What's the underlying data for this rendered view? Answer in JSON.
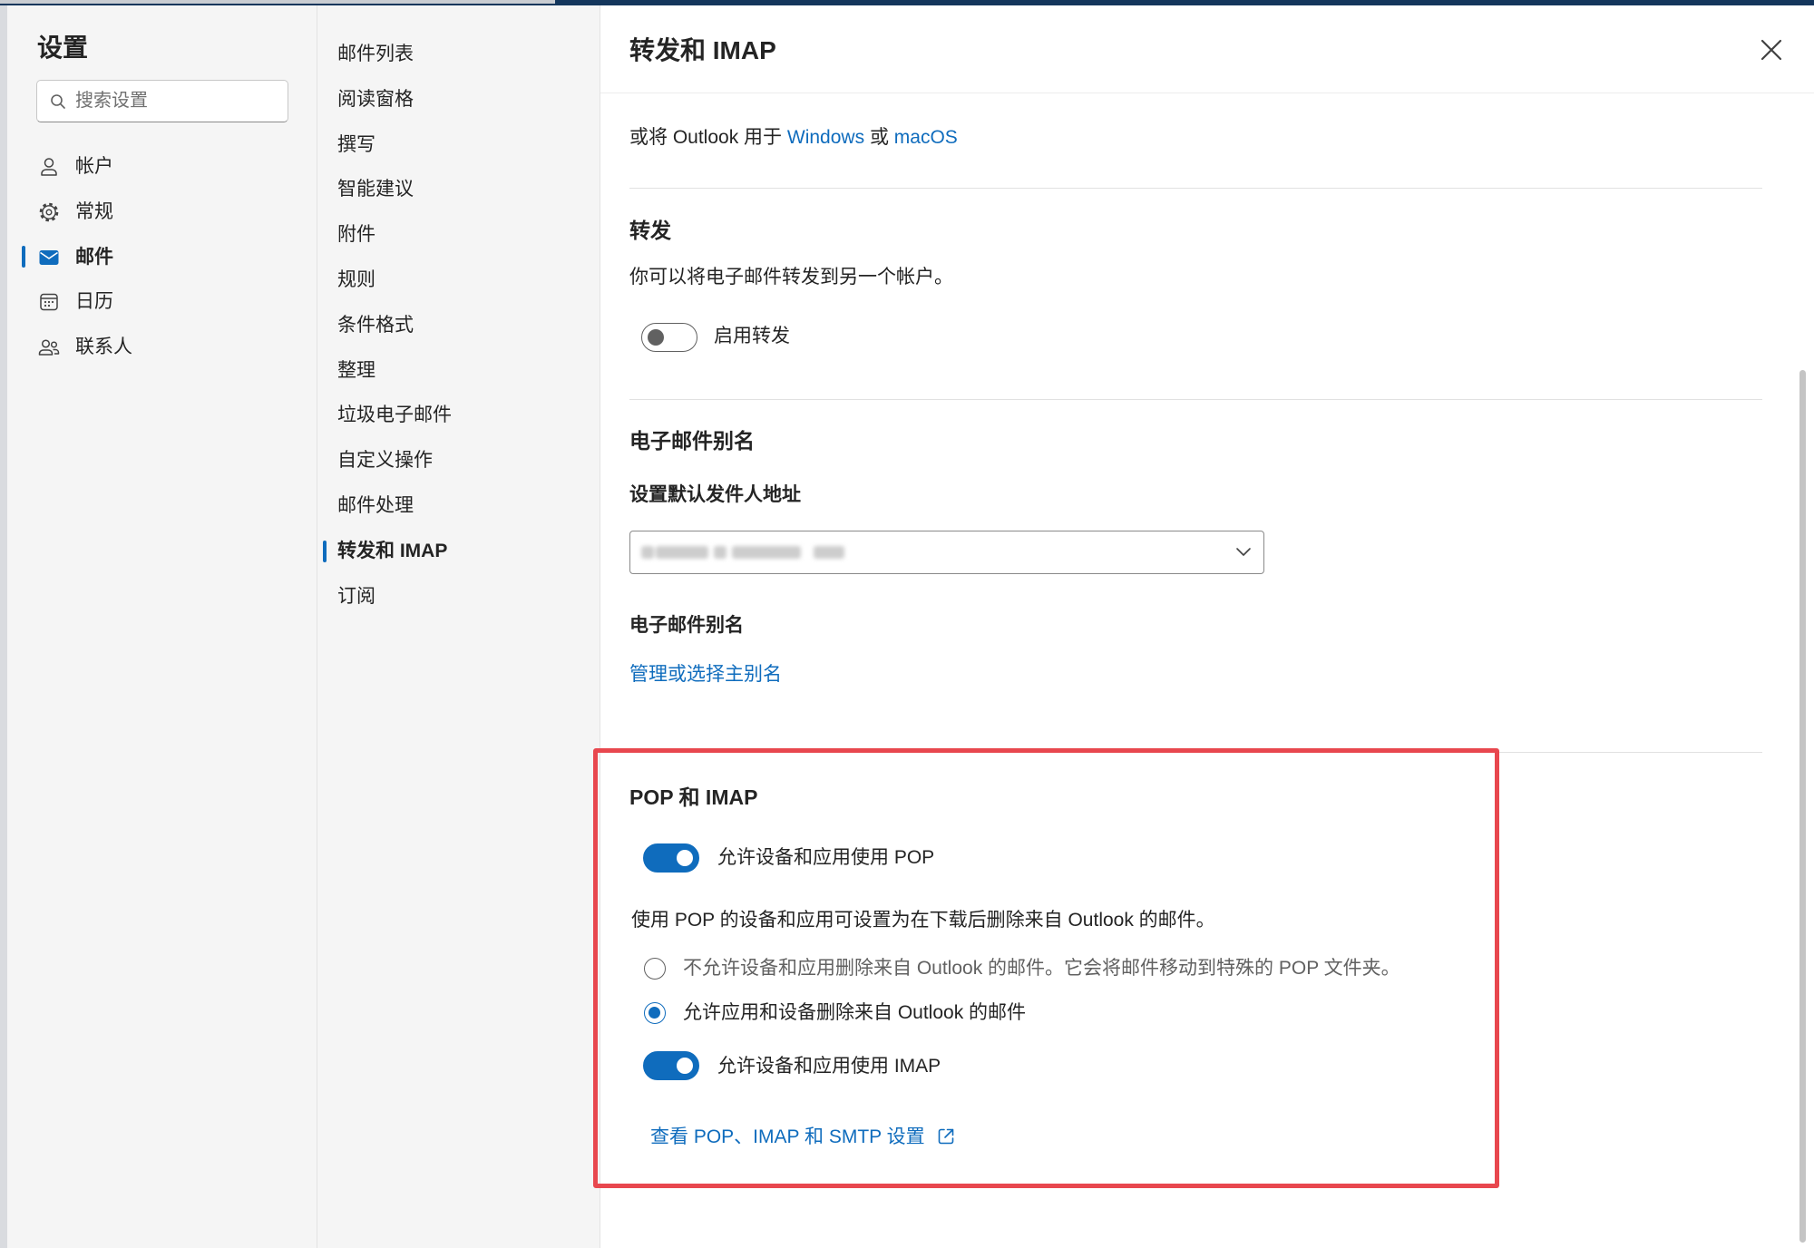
{
  "colors": {
    "accent": "#0f6cbd",
    "highlight_box": "#e8474e",
    "panel_background": "#f5f5f5",
    "text": "#242424",
    "muted_text": "#616161"
  },
  "sidebar": {
    "title": "设置",
    "search": {
      "placeholder": "搜索设置",
      "icon": "search-icon"
    },
    "items": [
      {
        "label": "帐户",
        "icon": "person-icon",
        "selected": false
      },
      {
        "label": "常规",
        "icon": "gear-icon",
        "selected": false
      },
      {
        "label": "邮件",
        "icon": "mail-icon",
        "selected": true
      },
      {
        "label": "日历",
        "icon": "calendar-icon",
        "selected": false
      },
      {
        "label": "联系人",
        "icon": "people-icon",
        "selected": false
      }
    ]
  },
  "subnav": {
    "items": [
      {
        "label": "邮件列表",
        "selected": false
      },
      {
        "label": "阅读窗格",
        "selected": false
      },
      {
        "label": "撰写",
        "selected": false
      },
      {
        "label": "智能建议",
        "selected": false
      },
      {
        "label": "附件",
        "selected": false
      },
      {
        "label": "规则",
        "selected": false
      },
      {
        "label": "条件格式",
        "selected": false
      },
      {
        "label": "整理",
        "selected": false
      },
      {
        "label": "垃圾电子邮件",
        "selected": false
      },
      {
        "label": "自定义操作",
        "selected": false
      },
      {
        "label": "邮件处理",
        "selected": false
      },
      {
        "label": "转发和 IMAP",
        "selected": true
      },
      {
        "label": "订阅",
        "selected": false
      }
    ]
  },
  "panel": {
    "title": "转发和 IMAP",
    "close_icon": "close-icon",
    "intro": {
      "prefix": "或将 Outlook 用于",
      "windows_link": "Windows",
      "or": "或",
      "macos_link": "macOS"
    },
    "forwarding": {
      "heading": "转发",
      "description": "你可以将电子邮件转发到另一个帐户。",
      "toggle_label": "启用转发",
      "enabled": false
    },
    "aliases": {
      "heading": "电子邮件别名",
      "default_from_label": "设置默认发件人地址",
      "dropdown_icon": "chevron-down-icon",
      "aliases_label": "电子邮件别名",
      "manage_link": "管理或选择主别名"
    },
    "pop_imap": {
      "heading": "POP 和 IMAP",
      "pop_toggle_label": "允许设备和应用使用 POP",
      "pop_enabled": true,
      "pop_note": "使用 POP 的设备和应用可设置为在下载后删除来自 Outlook 的邮件。",
      "delete_options": [
        {
          "label": "不允许设备和应用删除来自 Outlook 的邮件。它会将邮件移动到特殊的 POP 文件夹。",
          "selected": false
        },
        {
          "label": "允许应用和设备删除来自 Outlook 的邮件",
          "selected": true
        }
      ],
      "imap_toggle_label": "允许设备和应用使用 IMAP",
      "imap_enabled": true,
      "settings_link": "查看 POP、IMAP 和 SMTP 设置",
      "settings_link_icon": "open-external-icon"
    }
  }
}
